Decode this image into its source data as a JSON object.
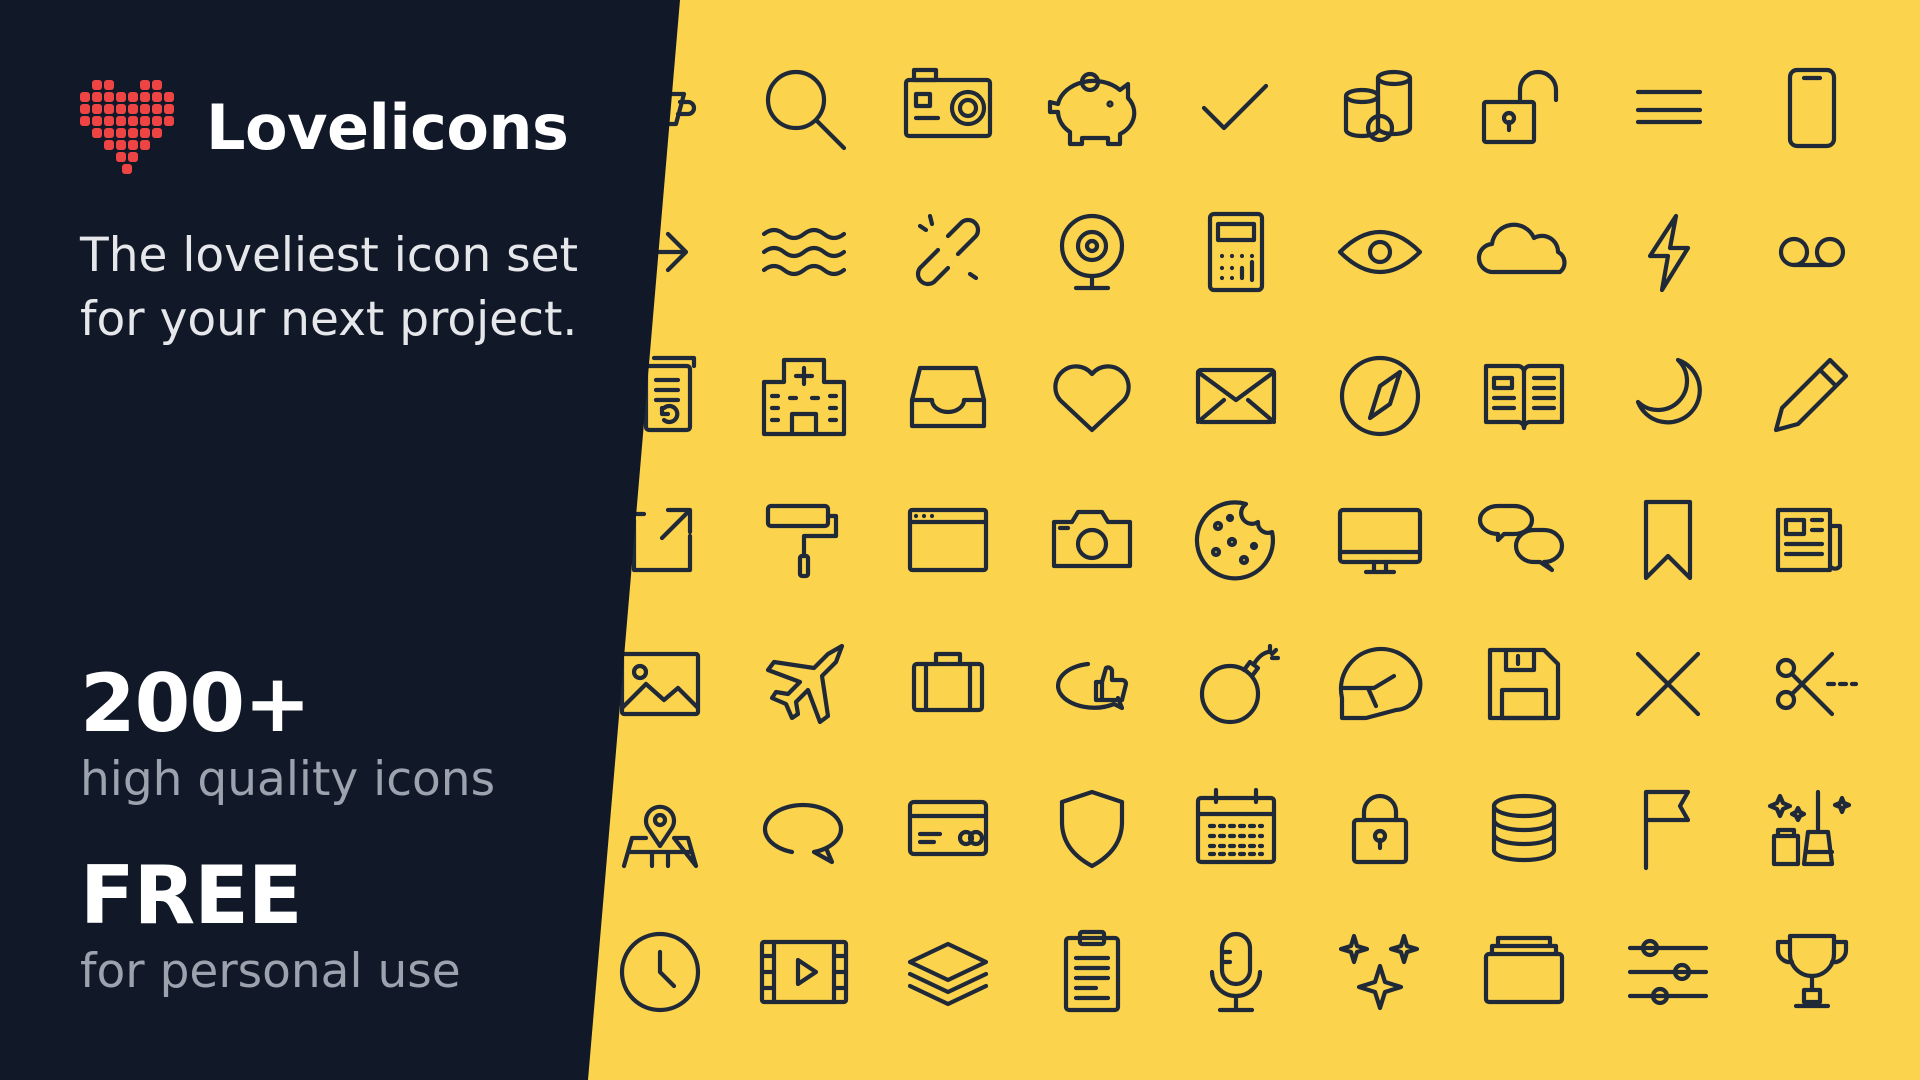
{
  "brand": {
    "name": "Lovelicons",
    "logo": "heart-pixel-logo",
    "logo_color": "#EF4444"
  },
  "tagline": {
    "line1": "The loveliest icon set",
    "line2": "for your next project."
  },
  "stats": {
    "count_value": "200+",
    "count_label": "high quality icons",
    "price_value": "FREE",
    "price_label": "for personal use"
  },
  "colors": {
    "panel_background": "#111827",
    "icon_background": "#FCD34D",
    "icon_stroke": "#1F2937"
  },
  "icon_grid": [
    [
      "cup-icon",
      "search-icon",
      "action-camera-icon",
      "piggy-bank-icon",
      "checkmark-icon",
      "coins-icon",
      "unlocked-padlock-icon",
      "menu-icon",
      "smartphone-icon"
    ],
    [
      "arrow-right-icon",
      "waves-icon",
      "broken-link-icon",
      "webcam-icon",
      "calculator-icon",
      "eye-icon",
      "cloud-icon",
      "lightning-icon",
      "voicemail-icon"
    ],
    [
      "document-history-icon",
      "hospital-icon",
      "inbox-tray-icon",
      "heart-icon",
      "envelope-icon",
      "compass-icon",
      "open-book-icon",
      "moon-icon",
      "pencil-icon"
    ],
    [
      "external-link-icon",
      "paint-roller-icon",
      "browser-window-icon",
      "camera-icon",
      "cookie-icon",
      "monitor-icon",
      "chat-bubbles-icon",
      "bookmark-icon",
      "newspaper-icon"
    ],
    [
      "image-icon",
      "airplane-icon",
      "briefcase-icon",
      "thumbs-up-bubble-icon",
      "bomb-icon",
      "helmet-icon",
      "floppy-disk-icon",
      "close-icon",
      "scissors-icon"
    ],
    [
      "map-pin-icon",
      "speech-bubble-icon",
      "credit-card-icon",
      "shield-icon",
      "calendar-icon",
      "padlock-icon",
      "database-icon",
      "flag-icon",
      "cleaning-icon"
    ],
    [
      "clock-icon",
      "video-film-icon",
      "layers-icon",
      "clipboard-icon",
      "microphone-icon",
      "sparkles-icon",
      "folder-icon",
      "sliders-icon",
      "trophy-icon"
    ]
  ]
}
